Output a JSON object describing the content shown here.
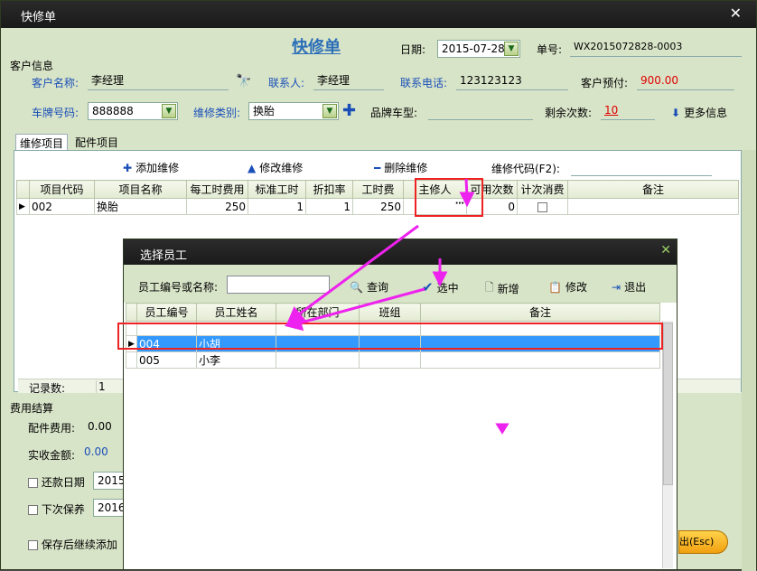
{
  "window": {
    "title": "快修单"
  },
  "form": {
    "heading": "快修单",
    "date_label": "日期:",
    "date_value": "2015-07-28",
    "order_no_label": "单号:",
    "order_no_value": "WX2015072828-0003"
  },
  "customer": {
    "section_label": "客户信息",
    "name_label": "客户名称:",
    "name_value": "李经理",
    "contact_label": "联系人:",
    "contact_value": "李经理",
    "phone_label": "联系电话:",
    "phone_value": "123123123",
    "prepay_label": "客户预付:",
    "prepay_value": "900.00",
    "plate_label": "车牌号码:",
    "plate_value": "888888",
    "repair_type_label": "维修类别:",
    "repair_type_value": "换胎",
    "brand_label": "品牌车型:",
    "brand_value": "",
    "remaining_label": "剩余次数:",
    "remaining_value": "10",
    "more_label": "更多信息"
  },
  "tabs": [
    "维修项目",
    "配件项目"
  ],
  "repair_toolbar": {
    "add": "添加维修",
    "edit": "修改维修",
    "delete": "删除维修",
    "code_label": "维修代码(F2):"
  },
  "repair_table": {
    "columns": [
      "项目代码",
      "项目名称",
      "每工时费用",
      "标准工时",
      "折扣率",
      "工时费",
      "主修人",
      "可用次数",
      "计次消费",
      "备注"
    ],
    "rows": [
      {
        "code": "002",
        "name": "换胎",
        "hourly": "250",
        "std_hours": "1",
        "discount": "1",
        "labor": "250",
        "worker": "",
        "avail": "0",
        "count": "",
        "note": ""
      }
    ],
    "record_label": "记录数:",
    "record_count": "1"
  },
  "settlement": {
    "section_label": "费用结算",
    "parts_fee_label": "配件费用:",
    "parts_fee_value": "0.00",
    "paid_label": "实收金额:",
    "paid_value": "0.00",
    "repay_date_label": "还款日期",
    "repay_date_value": "2015-",
    "next_maint_label": "下次保养",
    "next_maint_value": "2016-",
    "save_continue_label": "保存后继续添加",
    "exit_label": "出(Esc)"
  },
  "dialog": {
    "title": "选择员工",
    "search_label": "员工编号或名称:",
    "search_value": "",
    "query": "查询",
    "select": "选中",
    "add": "新增",
    "edit": "修改",
    "exit": "退出",
    "columns": [
      "员工编号",
      "员工姓名",
      "所在部门",
      "班组",
      "备注"
    ],
    "rows": [
      {
        "id": "004",
        "name": "小胡",
        "dept": "",
        "team": "",
        "note": ""
      },
      {
        "id": "005",
        "name": "小李",
        "dept": "",
        "team": "",
        "note": ""
      }
    ]
  },
  "colors": {
    "accent": "#1a4fb8",
    "highlight_row": "#3399ff",
    "annotation": "#ee22ee",
    "redbox": "#ee2222"
  }
}
